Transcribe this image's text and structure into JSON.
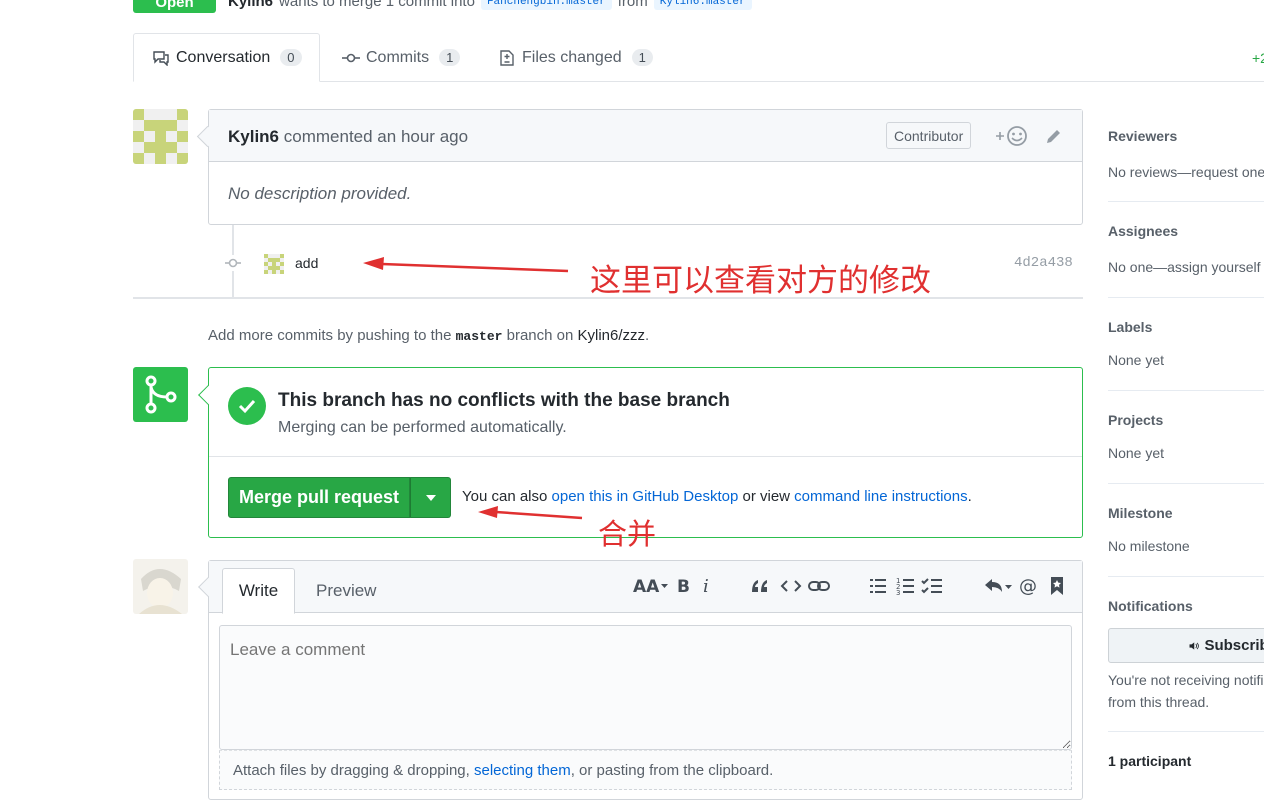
{
  "pr_header": {
    "state": "Open",
    "author": "Kylin6",
    "summary_text": "wants to merge 1 commit into",
    "base_ref": "Fanchengbin:master",
    "from_text": "from",
    "head_ref": "Kylin6:master"
  },
  "tabs": [
    {
      "label": "Conversation",
      "count": "0",
      "icon": "comment-discussion-icon"
    },
    {
      "label": "Commits",
      "count": "1",
      "icon": "git-commit-icon"
    },
    {
      "label": "Files changed",
      "count": "1",
      "icon": "file-diff-icon"
    }
  ],
  "diffstat": "+2",
  "comment": {
    "author": "Kylin6",
    "meta": "commented an hour ago",
    "role": "Contributor",
    "body": "No description provided."
  },
  "commit": {
    "message": "add",
    "sha": "4d2a438"
  },
  "push_hint": {
    "prefix": "Add more commits by pushing to the",
    "branch": "master",
    "middle": "branch on",
    "repo": "Kylin6/zzz",
    "suffix": "."
  },
  "merge": {
    "title": "This branch has no conflicts with the base branch",
    "subtitle": "Merging can be performed automatically.",
    "button_label": "Merge pull request",
    "alt_prefix": "You can also",
    "alt_link1": "open this in GitHub Desktop",
    "alt_middle": "or view",
    "alt_link2": "command line instructions",
    "alt_suffix": "."
  },
  "annotations": {
    "view_changes": "这里可以查看对方的修改",
    "merge": "合并",
    "color": "#e03030"
  },
  "new_comment": {
    "tab_write": "Write",
    "tab_preview": "Preview",
    "placeholder": "Leave a comment",
    "attach_prefix": "Attach files by dragging & dropping,",
    "attach_link": "selecting them",
    "attach_suffix": ", or pasting from the clipboard."
  },
  "sidebar": {
    "reviewers": {
      "title": "Reviewers",
      "value": "No reviews—request one"
    },
    "assignees": {
      "title": "Assignees",
      "value": "No one—assign yourself"
    },
    "labels": {
      "title": "Labels",
      "value": "None yet"
    },
    "projects": {
      "title": "Projects",
      "value": "None yet"
    },
    "milestone": {
      "title": "Milestone",
      "value": "No milestone"
    },
    "notifications": {
      "title": "Notifications",
      "button": "Subscribe",
      "line1": "You're not receiving notifications",
      "line2": "from this thread."
    },
    "participants": "1 participant"
  },
  "colors": {
    "open_green": "#2cbe4e",
    "merge_button": "#28a745",
    "link": "#0366d6"
  }
}
